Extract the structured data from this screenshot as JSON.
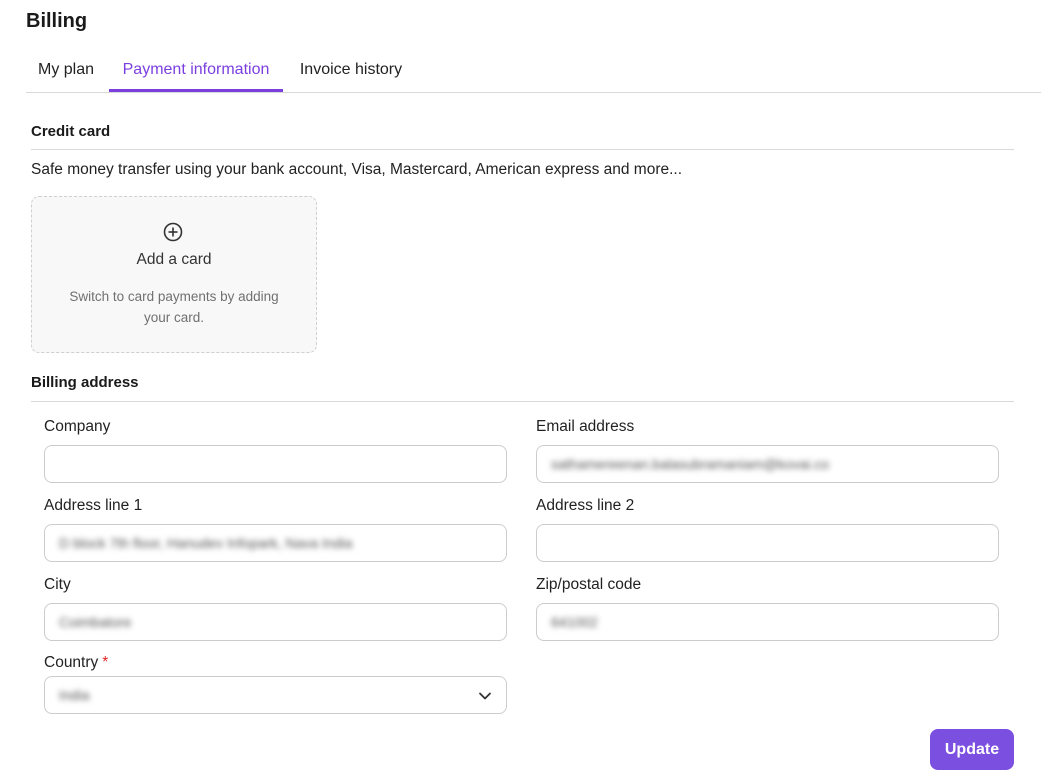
{
  "page": {
    "title": "Billing"
  },
  "tabs": [
    {
      "label": "My plan",
      "active": false
    },
    {
      "label": "Payment information",
      "active": true
    },
    {
      "label": "Invoice history",
      "active": false
    }
  ],
  "credit_card": {
    "title": "Credit card",
    "description": "Safe money transfer using your bank account, Visa, Mastercard, American express and more...",
    "add_card": {
      "icon": "plus-circle-icon",
      "label": "Add a card",
      "hint": "Switch to card payments by adding your card."
    }
  },
  "billing_address": {
    "title": "Billing address",
    "company": {
      "label": "Company",
      "value": ""
    },
    "email": {
      "label": "Email address",
      "value": "sathamereenan.balasubramaniam@kovai.co"
    },
    "address1": {
      "label": "Address line 1",
      "value": "D block 7th floor, Hanudev Infopark, Nava India"
    },
    "address2": {
      "label": "Address line 2",
      "value": ""
    },
    "city": {
      "label": "City",
      "value": "Coimbatore"
    },
    "zip": {
      "label": "Zip/postal code",
      "value": "641002"
    },
    "country": {
      "label": "Country",
      "required_mark": "*",
      "value": "India"
    }
  },
  "actions": {
    "update_label": "Update"
  },
  "colors": {
    "accent": "#7b3fe0",
    "button": "#7b4fe0",
    "required": "#e02424"
  }
}
